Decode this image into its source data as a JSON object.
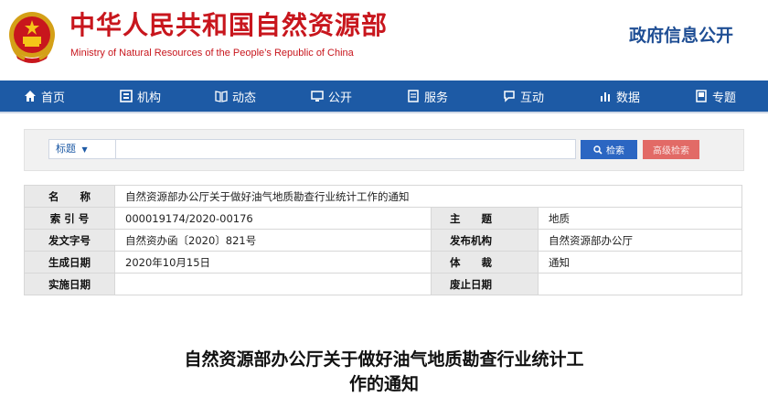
{
  "header": {
    "title_cn": "中华人民共和国自然资源部",
    "title_en": "Ministry of Natural Resources of the People’s Republic of China",
    "gov_info": "政府信息公开"
  },
  "nav": {
    "items": [
      {
        "label": "首页",
        "icon": "home-icon"
      },
      {
        "label": "机构",
        "icon": "org-icon"
      },
      {
        "label": "动态",
        "icon": "book-icon"
      },
      {
        "label": "公开",
        "icon": "monitor-icon"
      },
      {
        "label": "服务",
        "icon": "document-icon"
      },
      {
        "label": "互动",
        "icon": "chat-icon"
      },
      {
        "label": "数据",
        "icon": "bar-chart-icon"
      },
      {
        "label": "专题",
        "icon": "album-icon"
      }
    ]
  },
  "search": {
    "scope_label": "标题",
    "query": "",
    "search_label": "检索",
    "advanced_label": "高级检索"
  },
  "meta": {
    "name_label": "名　　称",
    "name_value": "自然资源部办公厅关于做好油气地质勘查行业统计工作的通知",
    "index_label": "索 引 号",
    "index_value": "000019174/2020-00176",
    "subject_label": "主　　题",
    "subject_value": "地质",
    "docno_label": "发文字号",
    "docno_value": "自然资办函〔2020〕821号",
    "issuer_label": "发布机构",
    "issuer_value": "自然资源部办公厅",
    "created_label": "生成日期",
    "created_value": "2020年10月15日",
    "genre_label": "体　　裁",
    "genre_value": "通知",
    "effective_label": "实施日期",
    "effective_value": "",
    "expire_label": "废止日期",
    "expire_value": ""
  },
  "article": {
    "title_line1": "自然资源部办公厅关于做好油气地质勘查行业统计工",
    "title_line2": "作的通知"
  },
  "colors": {
    "brand_red": "#c8161d",
    "nav_blue": "#1d5aa5",
    "search_blue": "#2b66c2",
    "advanced_red": "#e26a66"
  }
}
